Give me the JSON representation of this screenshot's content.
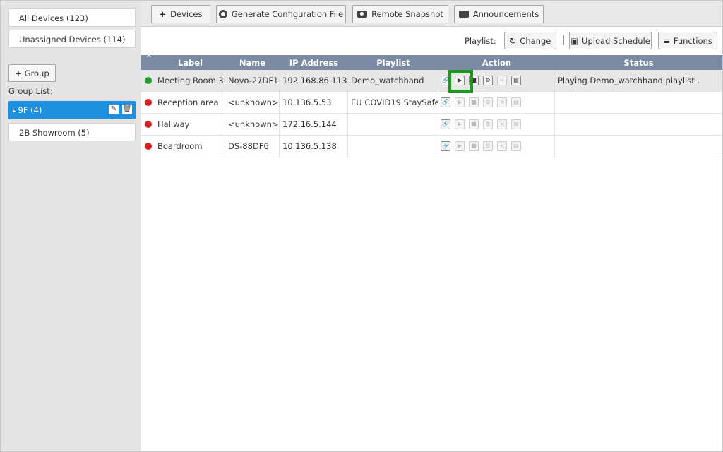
{
  "sidebar": {
    "all_devices": "All Devices (123)",
    "unassigned_devices": "Unassigned Devices (114)",
    "add_group": "+ Group",
    "group_list_label": "Group List:",
    "groups": [
      {
        "label": "9F (4)",
        "selected": true
      },
      {
        "label": "2B Showroom (5)",
        "selected": false
      }
    ]
  },
  "toolbar": {
    "devices": "Devices",
    "generate_config": "Generate Configuration File",
    "remote_snapshot": "Remote Snapshot",
    "announcements": "Announcements"
  },
  "playlist_bar": {
    "label": "Playlist:",
    "change": "Change",
    "separator": "|",
    "upload_schedule": "Upload Schedule",
    "functions": "Functions"
  },
  "table": {
    "columns": [
      "Label",
      "Name",
      "IP Address",
      "Playlist",
      "Action",
      "Status"
    ],
    "rows": [
      {
        "status_color": "#22a030",
        "label": "Meeting Room 3",
        "name": "Novo-27DF1",
        "ip": "192.168.86.113",
        "playlist": "Demo_watchhand",
        "status": "Playing Demo_watchhand playlist .",
        "selected": true
      },
      {
        "status_color": "#d82020",
        "label": "Reception area",
        "name": "<unknown>",
        "ip": "10.136.5.53",
        "playlist": "EU COVID19 StaySafe",
        "status": "",
        "selected": false
      },
      {
        "status_color": "#d82020",
        "label": "Hallway",
        "name": "<unknown>",
        "ip": "172.16.5.144",
        "playlist": "",
        "status": "",
        "selected": false
      },
      {
        "status_color": "#d82020",
        "label": "Boardroom",
        "name": "DS-88DF6",
        "ip": "10.136.5.138",
        "playlist": "",
        "status": "",
        "selected": false
      }
    ]
  },
  "colors": {
    "accent": "#1e90e0",
    "header_bg": "#7a8aa2",
    "highlight": "#1a9a1a"
  }
}
